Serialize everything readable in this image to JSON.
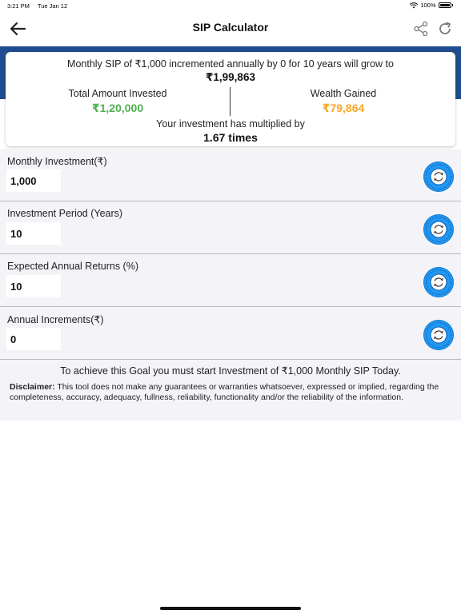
{
  "status_bar": {
    "time": "3:21 PM",
    "date": "Tue Jan 12",
    "battery": "100%"
  },
  "nav": {
    "title": "SIP Calculator"
  },
  "summary": {
    "headline": "Monthly SIP of ₹1,000 incremented annually by 0 for 10 years will grow to",
    "total_value": "₹1,99,863",
    "invested_label": "Total Amount Invested",
    "invested_value": "₹1,20,000",
    "wealth_label": "Wealth Gained",
    "wealth_value": "₹79,864",
    "multiplied_label": "Your investment has multiplied by",
    "multiplied_value": "1.67 times"
  },
  "fields": [
    {
      "label": "Monthly Investment(₹)",
      "value": "1,000"
    },
    {
      "label": "Investment Period (Years)",
      "value": "10"
    },
    {
      "label": "Expected Annual Returns (%)",
      "value": "10"
    },
    {
      "label": "Annual Increments(₹)",
      "value": "0"
    }
  ],
  "goal_text": "To achieve this Goal you must start Investment of ₹1,000 Monthly SIP Today.",
  "disclaimer": {
    "label": "Disclaimer:",
    "text": " This tool does not make any guarantees or warranties whatsoever, expressed or implied, regarding the completeness, accuracy, adequacy, fullness, reliability, functionality and/or the reliability of the information."
  },
  "colors": {
    "header_band": "#1f4d8f",
    "invested": "#4caf50",
    "wealth": "#f5a623",
    "action": "#2196f3"
  },
  "icons": {
    "back": "arrow-left-icon",
    "share": "share-icon",
    "refresh": "refresh-icon",
    "field_action": "sync-icon"
  }
}
